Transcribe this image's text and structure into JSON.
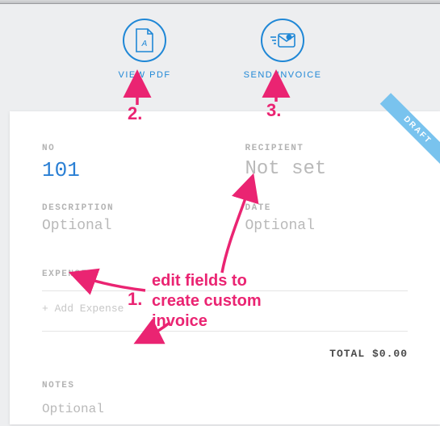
{
  "actions": {
    "pdf_label": "VIEW PDF",
    "send_label": "SEND INVOICE"
  },
  "badge": "DRAFT",
  "fields": {
    "no_label": "NO",
    "no_value": "101",
    "recipient_label": "RECIPIENT",
    "recipient_value": "Not set",
    "description_label": "DESCRIPTION",
    "description_value": "Optional",
    "date_label": "DATE",
    "date_value": "Optional"
  },
  "expenses": {
    "label": "EXPENSES",
    "add": "+ Add Expense",
    "total_label": "TOTAL",
    "total_value": "$0.00"
  },
  "notes": {
    "label": "NOTES",
    "value": "Optional"
  },
  "annotations": {
    "n1": "1.",
    "n2": "2.",
    "n3": "3.",
    "text": "edit fields to\ncreate custom\ninvoice"
  },
  "colors": {
    "accent": "#1f87d6",
    "anno": "#ea2472"
  }
}
